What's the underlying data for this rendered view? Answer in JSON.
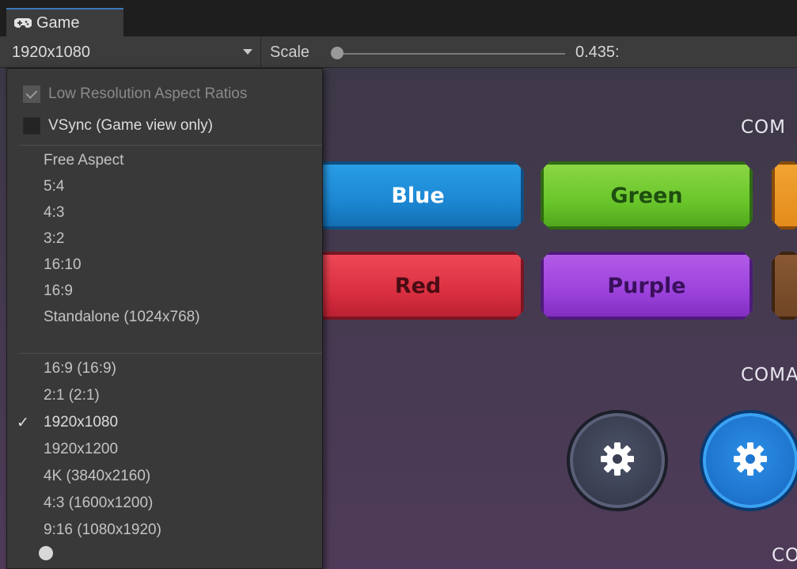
{
  "window": {
    "tab_title": "Game",
    "tab_icon": "gamepad-icon"
  },
  "toolbar": {
    "resolution_value": "1920x1080",
    "scale_label": "Scale",
    "scale_value": "0.435:",
    "scale_slider_fraction": 0.0
  },
  "dropdown": {
    "toggles": [
      {
        "label": "Low Resolution Aspect Ratios",
        "checked": true,
        "enabled": false
      },
      {
        "label": "VSync (Game view only)",
        "checked": false,
        "enabled": true
      }
    ],
    "builtin_items": [
      "Free Aspect",
      "5:4",
      "4:3",
      "3:2",
      "16:10",
      "16:9",
      "Standalone (1024x768)"
    ],
    "custom_items": [
      "16:9 (16:9)",
      "2:1 (2:1)",
      "1920x1080",
      "1920x1200",
      "4K (3840x2160)",
      "4:3 (1600x1200)",
      "9:16 (1080x1920)"
    ],
    "selected_item": "1920x1080",
    "checkmark_glyph": "✓"
  },
  "game": {
    "section_labels": [
      "COM",
      "COMA",
      "CO"
    ],
    "buttons": [
      {
        "label": "Blue",
        "color": "#1c86d2"
      },
      {
        "label": "Green",
        "color": "#69c52a"
      },
      {
        "label": "",
        "color": "#e38a1a"
      },
      {
        "label": "Red",
        "color": "#d92f40"
      },
      {
        "label": "Purple",
        "color": "#9b42dc"
      },
      {
        "label": "",
        "color": "#6e4424"
      }
    ],
    "circle_buttons": [
      {
        "icon": "gear-icon",
        "style": "dark"
      },
      {
        "icon": "gear-icon",
        "style": "blue"
      }
    ]
  },
  "colors": {
    "editor_bg": "#3c3c3c",
    "menu_bg": "#393939",
    "accent_tab": "#3a79bb"
  }
}
